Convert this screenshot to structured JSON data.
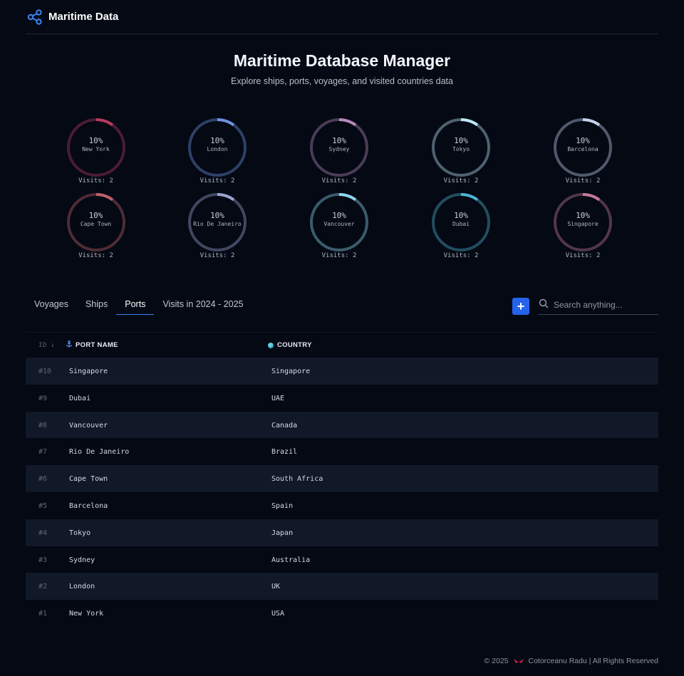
{
  "header": {
    "brand_title": "Maritime Data",
    "brand_icon": "share-nodes-icon",
    "accent": "#3b82f6"
  },
  "hero": {
    "title": "Maritime Database Manager",
    "subtitle": "Explore ships, ports, voyages, and visited countries data"
  },
  "gauges": [
    {
      "percent": "10%",
      "port": "New York",
      "visits": "Visits: 2",
      "fraction": 0.1,
      "color": "#b83a5e"
    },
    {
      "percent": "10%",
      "port": "London",
      "visits": "Visits: 2",
      "fraction": 0.1,
      "color": "#6d93e0"
    },
    {
      "percent": "10%",
      "port": "Sydney",
      "visits": "Visits: 2",
      "fraction": 0.1,
      "color": "#b78ab8"
    },
    {
      "percent": "10%",
      "port": "Tokyo",
      "visits": "Visits: 2",
      "fraction": 0.1,
      "color": "#bfe6f4"
    },
    {
      "percent": "10%",
      "port": "Barcelona",
      "visits": "Visits: 2",
      "fraction": 0.1,
      "color": "#c4d2ea"
    },
    {
      "percent": "10%",
      "port": "Cape Town",
      "visits": "Visits: 2",
      "fraction": 0.1,
      "color": "#c0606a"
    },
    {
      "percent": "10%",
      "port": "Rio De Janeiro",
      "visits": "Visits: 2",
      "fraction": 0.1,
      "color": "#9aa6cf"
    },
    {
      "percent": "10%",
      "port": "Vancouver",
      "visits": "Visits: 2",
      "fraction": 0.1,
      "color": "#8ed6ee"
    },
    {
      "percent": "10%",
      "port": "Dubai",
      "visits": "Visits: 2",
      "fraction": 0.1,
      "color": "#4fb3d2"
    },
    {
      "percent": "10%",
      "port": "Singapore",
      "visits": "Visits: 2",
      "fraction": 0.1,
      "color": "#c77a98"
    }
  ],
  "tabs": [
    {
      "label": "Voyages",
      "active": false
    },
    {
      "label": "Ships",
      "active": false
    },
    {
      "label": "Ports",
      "active": true
    },
    {
      "label": "Visits in 2024 - 2025",
      "active": false
    }
  ],
  "toolbar": {
    "add_label": "+",
    "search_placeholder": "Search anything..."
  },
  "table": {
    "headers": {
      "id": "ID ↓",
      "port_name": "PORT NAME",
      "country": "COUNTRY"
    },
    "rows": [
      {
        "id": "#10",
        "port": "Singapore",
        "country": "Singapore"
      },
      {
        "id": "#9",
        "port": "Dubai",
        "country": "UAE"
      },
      {
        "id": "#8",
        "port": "Vancouver",
        "country": "Canada"
      },
      {
        "id": "#7",
        "port": "Rio De Janeiro",
        "country": "Brazil"
      },
      {
        "id": "#6",
        "port": "Cape Town",
        "country": "South Africa"
      },
      {
        "id": "#5",
        "port": "Barcelona",
        "country": "Spain"
      },
      {
        "id": "#4",
        "port": "Tokyo",
        "country": "Japan"
      },
      {
        "id": "#3",
        "port": "Sydney",
        "country": "Australia"
      },
      {
        "id": "#2",
        "port": "London",
        "country": "UK"
      },
      {
        "id": "#1",
        "port": "New York",
        "country": "USA"
      }
    ]
  },
  "footer": {
    "prefix": "© 2025",
    "author": "Cotorceanu Radu | All Rights Reserved",
    "heart_color": "#e11d48"
  }
}
